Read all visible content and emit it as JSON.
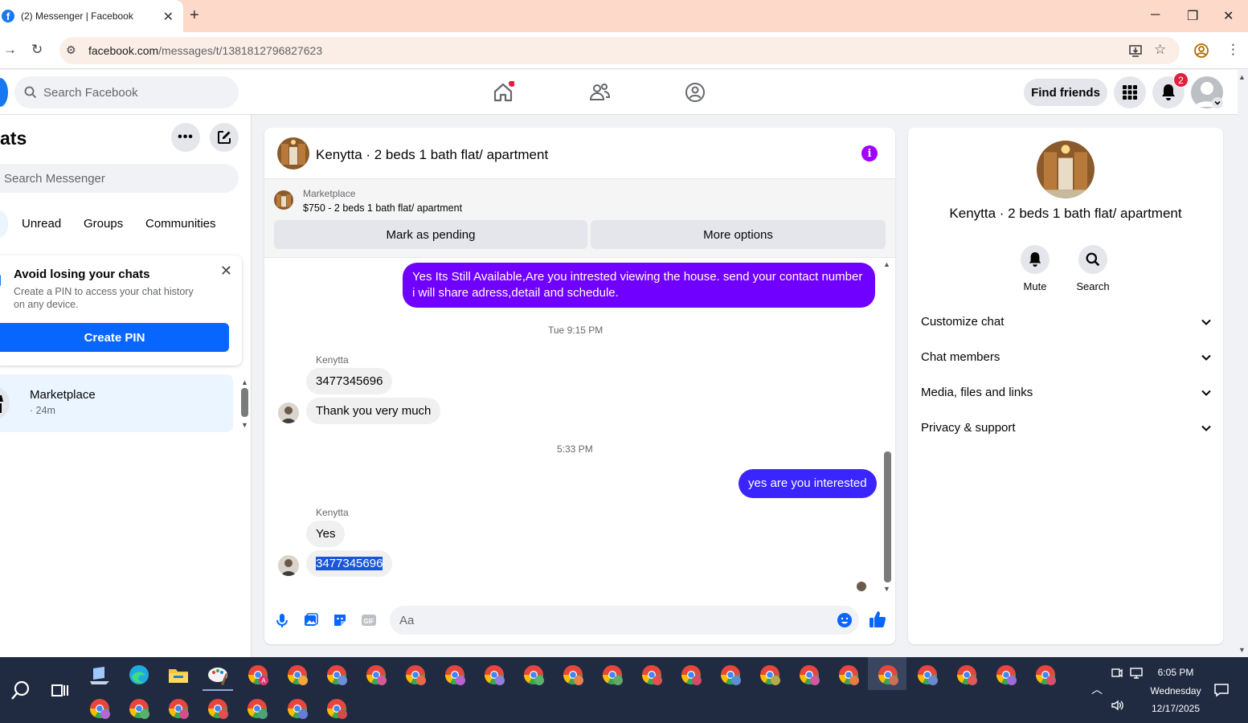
{
  "browser": {
    "tab_title": "(2) Messenger | Facebook",
    "url_host": "facebook.com",
    "url_path": "/messages/t/1381812796827623"
  },
  "header": {
    "search_placeholder": "Search Facebook",
    "find_friends": "Find friends",
    "notification_count": "2"
  },
  "sidebar": {
    "title": "ats",
    "search_placeholder": "Search Messenger",
    "filters": [
      "Unread",
      "Groups",
      "Communities"
    ],
    "pin_card": {
      "title": "Avoid losing your chats",
      "text": "Create a PIN to access your chat history on any device.",
      "button": "Create PIN"
    },
    "conversation": {
      "name": "Marketplace",
      "time": "· 24m"
    }
  },
  "chat": {
    "name": "Kenytta · 2 beds 1 bath flat/ apartment",
    "marketplace_label": "Marketplace",
    "listing": "$750 - 2 beds 1 bath flat/ apartment",
    "mark_pending": "Mark as pending",
    "more_options": "More options",
    "messages": {
      "out1": "Yes Its Still Available,Are you intrested viewing the house. send your contact number i will share adress,detail and schedule.",
      "stamp1": "Tue 9:15 PM",
      "sender1": "Kenytta",
      "in1": "3477345696",
      "in2": "Thank you very much",
      "stamp2": "5:33 PM",
      "out2": "yes are you interested",
      "sender2": "Kenytta",
      "in3": "Yes",
      "in4": "3477345696"
    },
    "composer_placeholder": "Aa"
  },
  "right_panel": {
    "name": "Kenytta · 2 beds 1 bath flat/ apartment",
    "mute": "Mute",
    "search": "Search",
    "sections": [
      "Customize chat",
      "Chat members",
      "Media, files and links",
      "Privacy & support"
    ]
  },
  "taskbar": {
    "time": "6:05 PM",
    "day": "Wednesday",
    "date": "12/17/2025"
  },
  "colors": {
    "brand_blue": "#0866ff",
    "outgoing_bubble": "#7000ff",
    "info_purple": "#a200ff",
    "badge_red": "#e41e3f",
    "taskbar": "#202b42"
  }
}
